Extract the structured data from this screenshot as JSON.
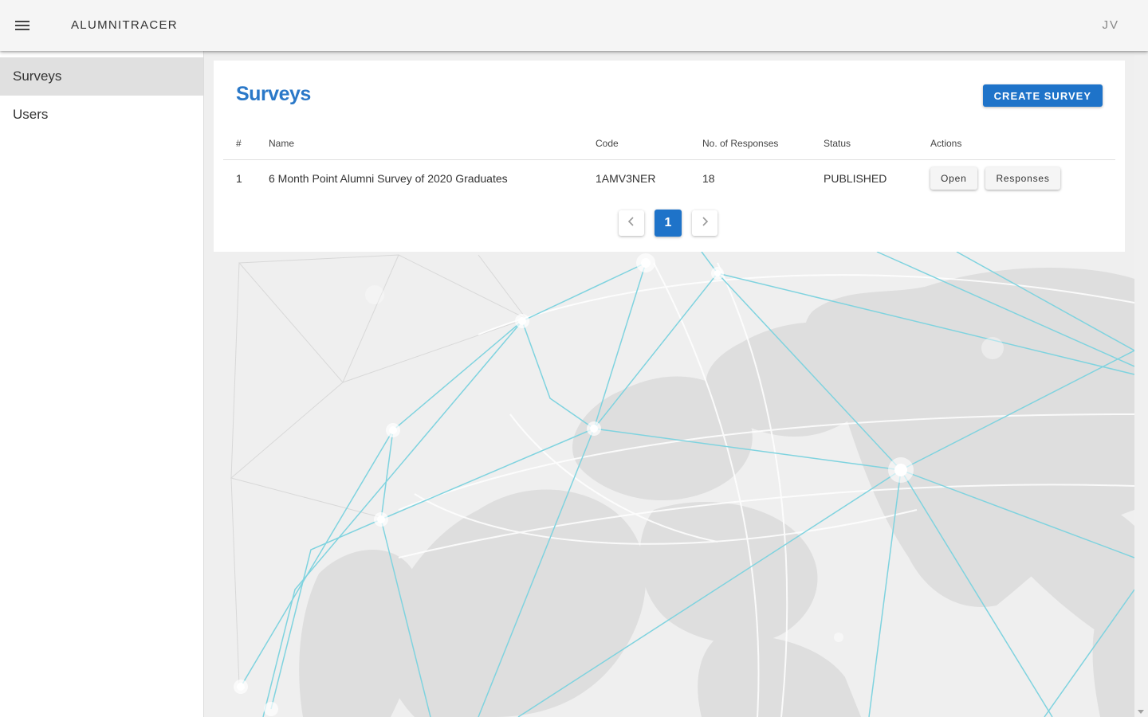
{
  "appbar": {
    "title": "ALUMNITRACER",
    "user_initials": "JV",
    "menu_icon": "hamburger-menu-icon"
  },
  "sidebar": {
    "items": [
      {
        "label": "Surveys",
        "active": true
      },
      {
        "label": "Users",
        "active": false
      }
    ]
  },
  "main": {
    "title": "Surveys",
    "create_button_label": "CREATE SURVEY",
    "table": {
      "headers": [
        "#",
        "Name",
        "Code",
        "No. of Responses",
        "Status",
        "Actions"
      ],
      "rows": [
        {
          "num": "1",
          "name": "6 Month Point Alumni Survey of 2020 Graduates",
          "code": "1AMV3NER",
          "responses": "18",
          "status": "PUBLISHED",
          "action_open": "Open",
          "action_responses": "Responses"
        }
      ]
    },
    "pagination": {
      "current_page": "1",
      "prev_icon": "chevron-left-icon",
      "next_icon": "chevron-right-icon"
    }
  },
  "colors": {
    "accent": "#1e73c9",
    "title": "#2a78c8",
    "network_lines": "#7fd3df"
  }
}
